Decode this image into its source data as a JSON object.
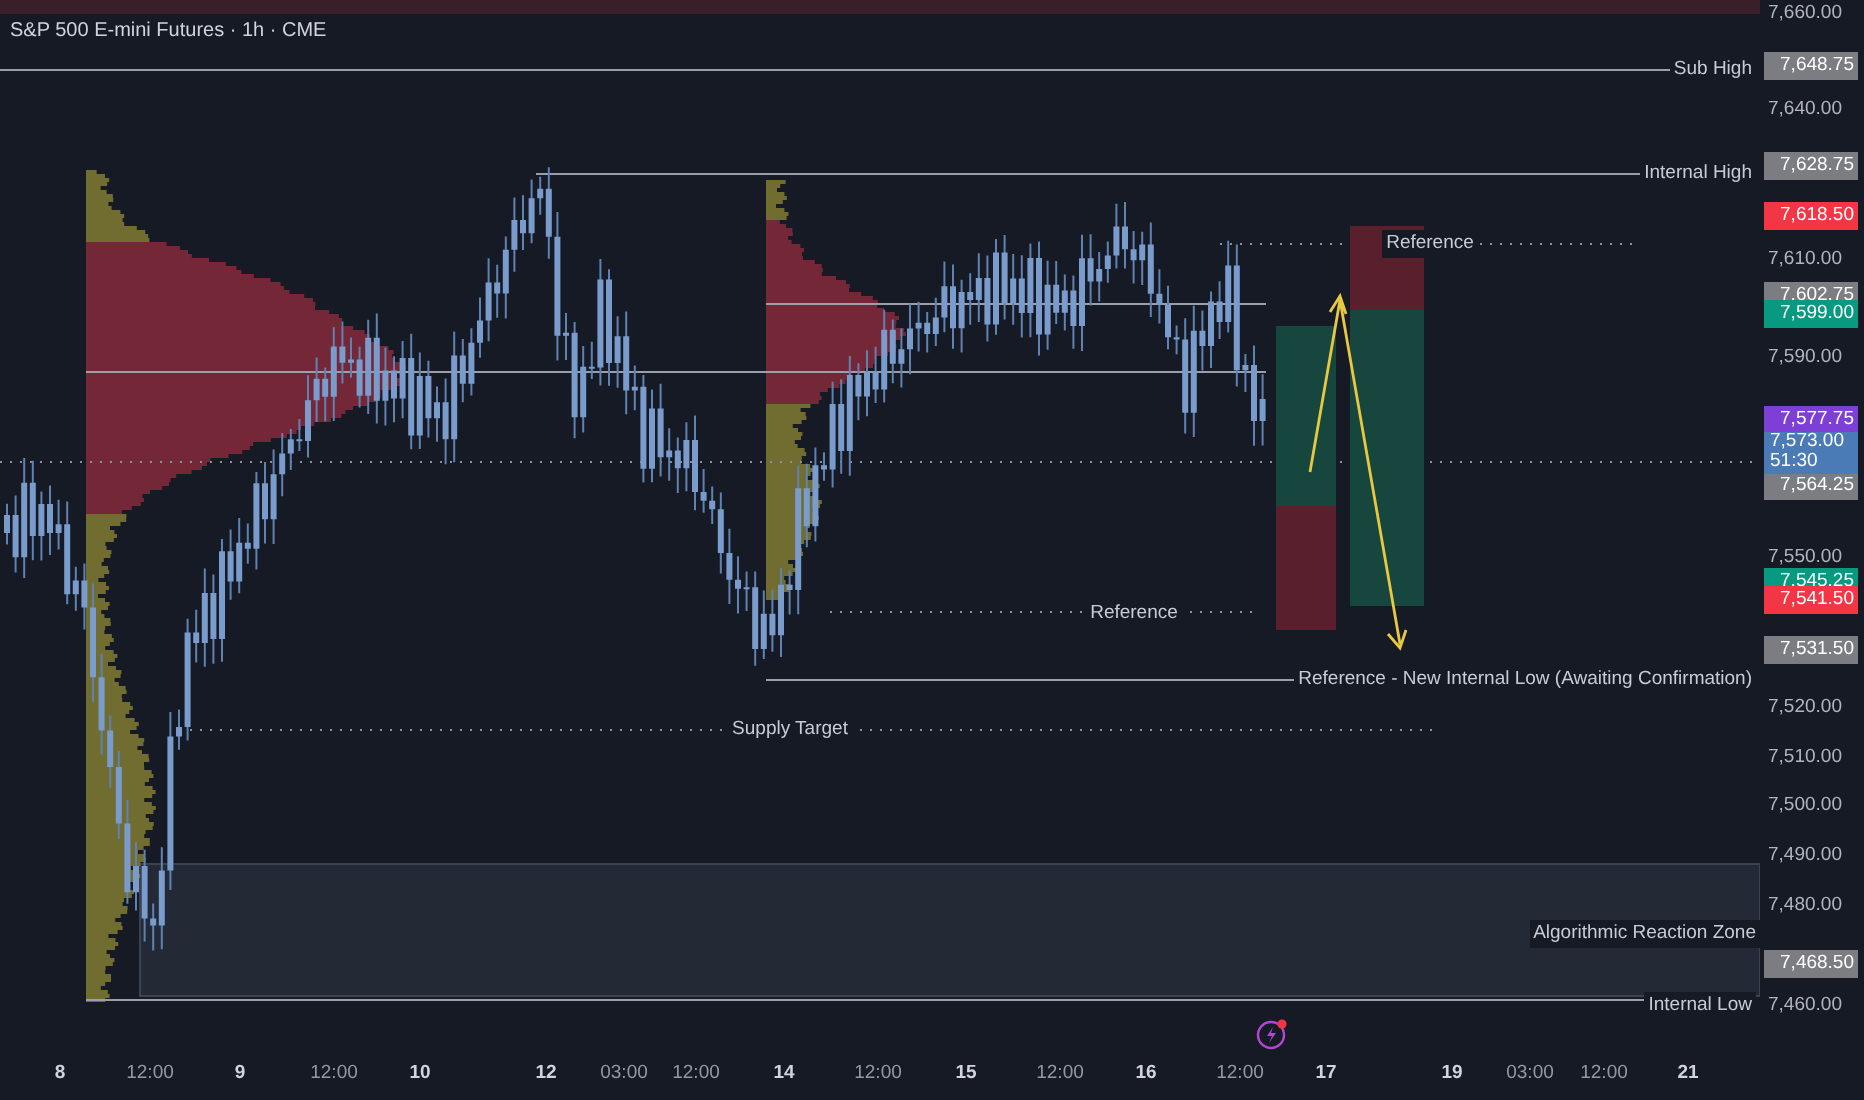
{
  "chart": {
    "title": "S&P 500 E-mini Futures · 1h · CME",
    "annotations": [
      {
        "text": "Sub High"
      },
      {
        "text": "Internal High"
      },
      {
        "text": "Reference"
      },
      {
        "text": "Reference"
      },
      {
        "text": "Reference - New Internal Low (Awaiting Confirmation)"
      },
      {
        "text": "Supply Target"
      },
      {
        "text": "Algorithmic Reaction Zone"
      },
      {
        "text": "Internal Low"
      }
    ]
  },
  "price_axis": {
    "ticks": [
      "7,660.00",
      "7,640.00",
      "7,610.00",
      "7,590.00",
      "7,550.00",
      "7,520.00",
      "7,510.00",
      "7,500.00",
      "7,490.00",
      "7,480.00",
      "7,460.00"
    ],
    "badges": [
      {
        "text": "7,648.75",
        "color": "#7b7d82"
      },
      {
        "text": "7,628.75",
        "color": "#7b7d82"
      },
      {
        "text": "7,618.50",
        "color": "#f23645"
      },
      {
        "text": "7,602.75",
        "color": "#7b7d82"
      },
      {
        "text": "7,599.00",
        "color": "#089981"
      },
      {
        "text": "7,577.75",
        "color": "#7e3fd6"
      },
      {
        "text": "7,573.00",
        "countdown": "51:30",
        "color": "#4a7bb7"
      },
      {
        "text": "7,564.25",
        "color": "#7b7d82"
      },
      {
        "text": "7,545.25",
        "color": "#089981"
      },
      {
        "text": "7,541.50",
        "color": "#f23645"
      },
      {
        "text": "7,531.50",
        "color": "#7b7d82"
      },
      {
        "text": "7,468.50",
        "color": "#7b7d82"
      }
    ]
  },
  "time_axis": [
    {
      "label": "8",
      "kind": "day"
    },
    {
      "label": "12:00",
      "kind": "time"
    },
    {
      "label": "9",
      "kind": "day"
    },
    {
      "label": "12:00",
      "kind": "time"
    },
    {
      "label": "10",
      "kind": "day"
    },
    {
      "label": "12",
      "kind": "day"
    },
    {
      "label": "03:00",
      "kind": "time"
    },
    {
      "label": "12:00",
      "kind": "time"
    },
    {
      "label": "14",
      "kind": "day"
    },
    {
      "label": "12:00",
      "kind": "time"
    },
    {
      "label": "15",
      "kind": "day"
    },
    {
      "label": "12:00",
      "kind": "time"
    },
    {
      "label": "16",
      "kind": "day"
    },
    {
      "label": "12:00",
      "kind": "time"
    },
    {
      "label": "17",
      "kind": "day"
    },
    {
      "label": "19",
      "kind": "day"
    },
    {
      "label": "03:00",
      "kind": "time"
    },
    {
      "label": "12:00",
      "kind": "time"
    },
    {
      "label": "21",
      "kind": "day"
    }
  ]
}
